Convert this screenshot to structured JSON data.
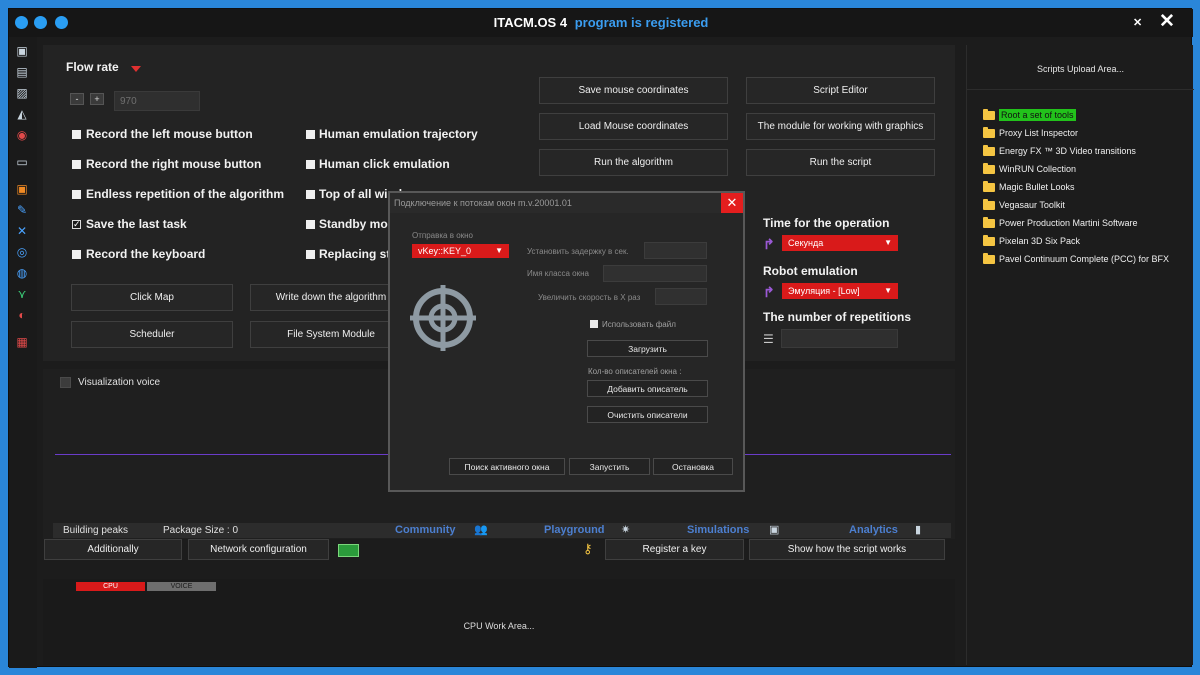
{
  "window": {
    "title_main": "ITACM.OS 4",
    "title_status": "program is registered",
    "close_glyph": "✕",
    "pin_glyph": "✕"
  },
  "sidebar_icons": [
    "briefcase-icon",
    "printer-icon",
    "image-icon",
    "shapes-icon",
    "globe-icon",
    "window-icon",
    "box-icon",
    "wrench-icon",
    "network-icon",
    "target-icon",
    "ring-icon",
    "tree-icon",
    "yinyang-icon",
    "checker-icon"
  ],
  "flow": {
    "label": "Flow rate",
    "minus": "-",
    "plus": "+",
    "value": "970"
  },
  "options_left": [
    {
      "label": "Record the left mouse button",
      "checked": false
    },
    {
      "label": "Record the right mouse button",
      "checked": false
    },
    {
      "label": "Endless repetition of the algorithm",
      "checked": false
    },
    {
      "label": "Save the last task",
      "checked": true
    },
    {
      "label": "Record the keyboard",
      "checked": false
    }
  ],
  "options_right": [
    {
      "label": "Human emulation trajectory",
      "checked": false
    },
    {
      "label": "Human click emulation",
      "checked": false
    },
    {
      "label": "Top of all windows",
      "checked": false
    },
    {
      "label": "Standby mode",
      "checked": false
    },
    {
      "label": "Replacing stop",
      "checked": false
    }
  ],
  "buttons": {
    "click_map": "Click Map",
    "write_algorithm": "Write down the algorithm",
    "scheduler": "Scheduler",
    "file_system": "File System Module",
    "save_mouse": "Save mouse coordinates",
    "load_mouse": "Load Mouse coordinates",
    "run_algorithm": "Run the algorithm",
    "script_editor": "Script Editor",
    "graphics_module": "The module for working with graphics",
    "run_script": "Run the script",
    "additionally": "Additionally",
    "network_config": "Network configuration",
    "register_key": "Register a key",
    "show_script": "Show how the script works"
  },
  "right_settings": {
    "time_label": "Time for the operation",
    "time_value": "Секунда",
    "robot_label": "Robot emulation",
    "robot_value": "Эмуляция - [Low]",
    "repetitions_label": "The number of repetitions"
  },
  "viz": {
    "voice_label": "Visualization voice",
    "building_peaks": "Building peaks",
    "package_size": "Package Size : 0"
  },
  "tabs": [
    {
      "label": "Community",
      "icon": "users-icon"
    },
    {
      "label": "Playground",
      "icon": "confetti-icon"
    },
    {
      "label": "Simulations",
      "icon": "robot-icon"
    },
    {
      "label": "Analytics",
      "icon": "bar-chart-icon"
    }
  ],
  "cpu": {
    "cpu_tab": "CPU",
    "voice_tab": "VOICE",
    "area_label": "CPU Work Area..."
  },
  "scripts_panel": {
    "header": "Scripts Upload Area...",
    "items": [
      "Root a set of tools",
      "Proxy List Inspector",
      "Energy FX ™ 3D Video transitions",
      "WinRUN Collection",
      "Magic Bullet Looks",
      "Vegasaur Toolkit",
      "Power Production Martini Software",
      "Pixelan 3D Six Pack",
      "Pavel Continuum Complete (PCC) for BFX"
    ],
    "highlight_color": "#22c21b"
  },
  "dialog": {
    "title": "Подключение к потокам окон m.v.20001.01",
    "close": "✕",
    "send_to_window": "Отправка в окно",
    "key_value": "vKey::KEY_0",
    "set_delay": "Установить задержку в сек.",
    "class_name": "Имя класса окна",
    "speed_up": "Увеличить скорость в X раз",
    "use_file": "Использовать файл",
    "load": "Загрузить",
    "descriptors_count": "Кол-во описателей окна :",
    "add_descriptor": "Добавить описатель",
    "clear_descriptors": "Очистить описатели",
    "find_active": "Поиск активного окна",
    "start": "Запустить",
    "stop": "Остановка"
  },
  "colors": {
    "accent_blue": "#2a86d9",
    "red": "#d91a1a",
    "link_blue": "#4c7fd0",
    "purple_line": "#6a3cc9"
  }
}
